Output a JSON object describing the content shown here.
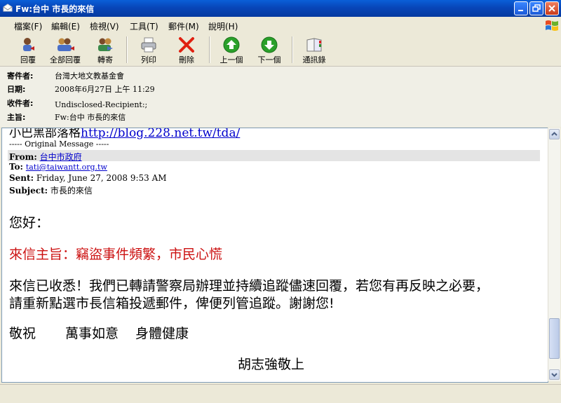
{
  "window": {
    "title": "Fw:台中 市長的來信"
  },
  "menu": [
    "檔案(F)",
    "編輯(E)",
    "檢視(V)",
    "工具(T)",
    "郵件(M)",
    "說明(H)"
  ],
  "toolbar": {
    "reply": "回覆",
    "reply_all": "全部回覆",
    "forward": "轉寄",
    "print": "列印",
    "delete": "刪除",
    "previous": "上一個",
    "next": "下一個",
    "addresses": "通訊錄"
  },
  "header": {
    "from_label": "寄件者:",
    "from_value": "台灣大地文教基金會",
    "date_label": "日期:",
    "date_value": "2008年6月27日 上午 11:29",
    "to_label": "收件者:",
    "to_value": "Undisclosed-Recipient:;",
    "subject_label": "主旨:",
    "subject_value": "Fw:台中 市長的來信"
  },
  "message": {
    "top_line_prefix": "小巴黑部落格",
    "top_line_link": "http://blog.228.net.tw/tda/",
    "original_message": "----- Original Message -----",
    "from_label": "From:",
    "from_value": "台中市政府",
    "to_label": "To:",
    "to_value": "tati@taiwantt.org.tw",
    "sent_label": "Sent:",
    "sent_value": "Friday, June 27, 2008 9:53 AM",
    "subject_label": "Subject:",
    "subject_value": "市長的來信",
    "greeting": "您好：",
    "topic": "來信主旨：竊盜事件頻繁，市民心慌",
    "para_line1": "來信已收悉！我們已轉請警察局辦理並持續追蹤儘速回覆，若您有再反映之必要，",
    "para_line2": "請重新點選市長信箱投遞郵件，俾便列管追蹤。謝謝您!",
    "closing_1": "敬祝",
    "closing_2": "萬事如意",
    "closing_3": "身體健康",
    "signature": "胡志強敬上"
  },
  "colors": {
    "topic": "#cc1111",
    "link": "#0000cc"
  }
}
